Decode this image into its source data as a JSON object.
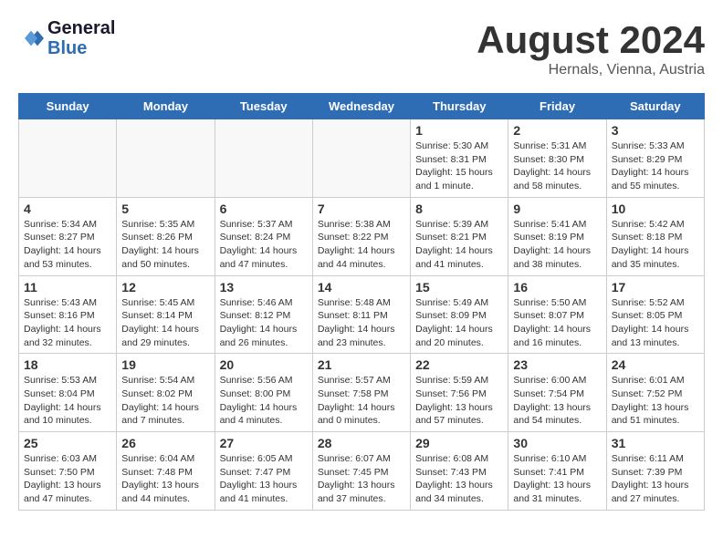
{
  "header": {
    "logo_line1": "General",
    "logo_line2": "Blue",
    "month_title": "August 2024",
    "subtitle": "Hernals, Vienna, Austria"
  },
  "weekdays": [
    "Sunday",
    "Monday",
    "Tuesday",
    "Wednesday",
    "Thursday",
    "Friday",
    "Saturday"
  ],
  "weeks": [
    [
      {
        "day": "",
        "info": ""
      },
      {
        "day": "",
        "info": ""
      },
      {
        "day": "",
        "info": ""
      },
      {
        "day": "",
        "info": ""
      },
      {
        "day": "1",
        "info": "Sunrise: 5:30 AM\nSunset: 8:31 PM\nDaylight: 15 hours\nand 1 minute."
      },
      {
        "day": "2",
        "info": "Sunrise: 5:31 AM\nSunset: 8:30 PM\nDaylight: 14 hours\nand 58 minutes."
      },
      {
        "day": "3",
        "info": "Sunrise: 5:33 AM\nSunset: 8:29 PM\nDaylight: 14 hours\nand 55 minutes."
      }
    ],
    [
      {
        "day": "4",
        "info": "Sunrise: 5:34 AM\nSunset: 8:27 PM\nDaylight: 14 hours\nand 53 minutes."
      },
      {
        "day": "5",
        "info": "Sunrise: 5:35 AM\nSunset: 8:26 PM\nDaylight: 14 hours\nand 50 minutes."
      },
      {
        "day": "6",
        "info": "Sunrise: 5:37 AM\nSunset: 8:24 PM\nDaylight: 14 hours\nand 47 minutes."
      },
      {
        "day": "7",
        "info": "Sunrise: 5:38 AM\nSunset: 8:22 PM\nDaylight: 14 hours\nand 44 minutes."
      },
      {
        "day": "8",
        "info": "Sunrise: 5:39 AM\nSunset: 8:21 PM\nDaylight: 14 hours\nand 41 minutes."
      },
      {
        "day": "9",
        "info": "Sunrise: 5:41 AM\nSunset: 8:19 PM\nDaylight: 14 hours\nand 38 minutes."
      },
      {
        "day": "10",
        "info": "Sunrise: 5:42 AM\nSunset: 8:18 PM\nDaylight: 14 hours\nand 35 minutes."
      }
    ],
    [
      {
        "day": "11",
        "info": "Sunrise: 5:43 AM\nSunset: 8:16 PM\nDaylight: 14 hours\nand 32 minutes."
      },
      {
        "day": "12",
        "info": "Sunrise: 5:45 AM\nSunset: 8:14 PM\nDaylight: 14 hours\nand 29 minutes."
      },
      {
        "day": "13",
        "info": "Sunrise: 5:46 AM\nSunset: 8:12 PM\nDaylight: 14 hours\nand 26 minutes."
      },
      {
        "day": "14",
        "info": "Sunrise: 5:48 AM\nSunset: 8:11 PM\nDaylight: 14 hours\nand 23 minutes."
      },
      {
        "day": "15",
        "info": "Sunrise: 5:49 AM\nSunset: 8:09 PM\nDaylight: 14 hours\nand 20 minutes."
      },
      {
        "day": "16",
        "info": "Sunrise: 5:50 AM\nSunset: 8:07 PM\nDaylight: 14 hours\nand 16 minutes."
      },
      {
        "day": "17",
        "info": "Sunrise: 5:52 AM\nSunset: 8:05 PM\nDaylight: 14 hours\nand 13 minutes."
      }
    ],
    [
      {
        "day": "18",
        "info": "Sunrise: 5:53 AM\nSunset: 8:04 PM\nDaylight: 14 hours\nand 10 minutes."
      },
      {
        "day": "19",
        "info": "Sunrise: 5:54 AM\nSunset: 8:02 PM\nDaylight: 14 hours\nand 7 minutes."
      },
      {
        "day": "20",
        "info": "Sunrise: 5:56 AM\nSunset: 8:00 PM\nDaylight: 14 hours\nand 4 minutes."
      },
      {
        "day": "21",
        "info": "Sunrise: 5:57 AM\nSunset: 7:58 PM\nDaylight: 14 hours\nand 0 minutes."
      },
      {
        "day": "22",
        "info": "Sunrise: 5:59 AM\nSunset: 7:56 PM\nDaylight: 13 hours\nand 57 minutes."
      },
      {
        "day": "23",
        "info": "Sunrise: 6:00 AM\nSunset: 7:54 PM\nDaylight: 13 hours\nand 54 minutes."
      },
      {
        "day": "24",
        "info": "Sunrise: 6:01 AM\nSunset: 7:52 PM\nDaylight: 13 hours\nand 51 minutes."
      }
    ],
    [
      {
        "day": "25",
        "info": "Sunrise: 6:03 AM\nSunset: 7:50 PM\nDaylight: 13 hours\nand 47 minutes."
      },
      {
        "day": "26",
        "info": "Sunrise: 6:04 AM\nSunset: 7:48 PM\nDaylight: 13 hours\nand 44 minutes."
      },
      {
        "day": "27",
        "info": "Sunrise: 6:05 AM\nSunset: 7:47 PM\nDaylight: 13 hours\nand 41 minutes."
      },
      {
        "day": "28",
        "info": "Sunrise: 6:07 AM\nSunset: 7:45 PM\nDaylight: 13 hours\nand 37 minutes."
      },
      {
        "day": "29",
        "info": "Sunrise: 6:08 AM\nSunset: 7:43 PM\nDaylight: 13 hours\nand 34 minutes."
      },
      {
        "day": "30",
        "info": "Sunrise: 6:10 AM\nSunset: 7:41 PM\nDaylight: 13 hours\nand 31 minutes."
      },
      {
        "day": "31",
        "info": "Sunrise: 6:11 AM\nSunset: 7:39 PM\nDaylight: 13 hours\nand 27 minutes."
      }
    ]
  ]
}
